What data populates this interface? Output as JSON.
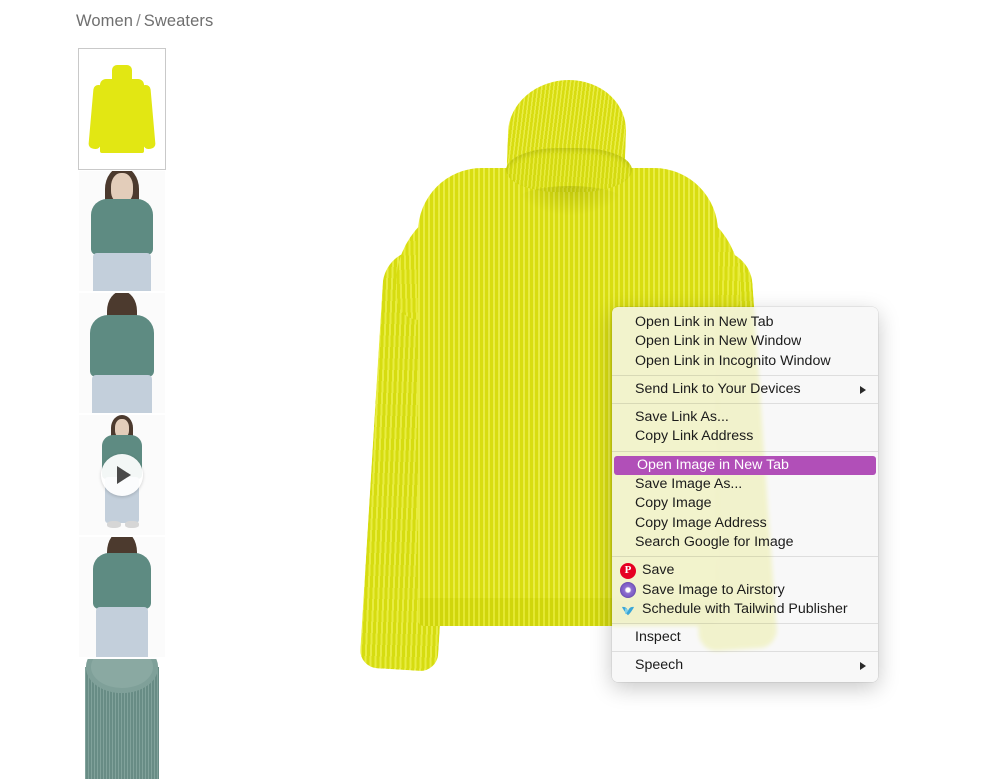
{
  "breadcrumb": {
    "items": [
      "Women",
      "Sweaters"
    ],
    "separator": "/"
  },
  "gallery": {
    "thumbnails": [
      {
        "name": "yellow-turtleneck-flat",
        "selected": true,
        "has_video": false,
        "kind": "product-flat",
        "color": "#e2e713"
      },
      {
        "name": "teal-turtleneck-front",
        "selected": false,
        "has_video": false,
        "kind": "model-front",
        "color": "#5e8b82"
      },
      {
        "name": "teal-turtleneck-back",
        "selected": false,
        "has_video": false,
        "kind": "model-back",
        "color": "#5e8b82"
      },
      {
        "name": "teal-turtleneck-video",
        "selected": false,
        "has_video": true,
        "kind": "model-full",
        "color": "#5e8b82"
      },
      {
        "name": "teal-turtleneck-side",
        "selected": false,
        "has_video": false,
        "kind": "model-side",
        "color": "#5e8b82"
      },
      {
        "name": "teal-knit-detail",
        "selected": false,
        "has_video": false,
        "kind": "fabric-detail",
        "color": "#6e948c"
      }
    ],
    "play_icon": "play-icon"
  },
  "hero": {
    "name": "yellow-ribbed-turtleneck-sweater",
    "color": "#e4e814"
  },
  "context_menu": {
    "highlight_color": "#b14fb8",
    "groups": [
      {
        "items": [
          {
            "label": "Open Link in New Tab",
            "submenu": false,
            "highlighted": false,
            "icon": null
          },
          {
            "label": "Open Link in New Window",
            "submenu": false,
            "highlighted": false,
            "icon": null
          },
          {
            "label": "Open Link in Incognito Window",
            "submenu": false,
            "highlighted": false,
            "icon": null
          }
        ]
      },
      {
        "items": [
          {
            "label": "Send Link to Your Devices",
            "submenu": true,
            "highlighted": false,
            "icon": null
          }
        ]
      },
      {
        "items": [
          {
            "label": "Save Link As...",
            "submenu": false,
            "highlighted": false,
            "icon": null
          },
          {
            "label": "Copy Link Address",
            "submenu": false,
            "highlighted": false,
            "icon": null
          }
        ]
      },
      {
        "items": [
          {
            "label": "Open Image in New Tab",
            "submenu": false,
            "highlighted": true,
            "icon": null
          },
          {
            "label": "Save Image As...",
            "submenu": false,
            "highlighted": false,
            "icon": null
          },
          {
            "label": "Copy Image",
            "submenu": false,
            "highlighted": false,
            "icon": null
          },
          {
            "label": "Copy Image Address",
            "submenu": false,
            "highlighted": false,
            "icon": null
          },
          {
            "label": "Search Google for Image",
            "submenu": false,
            "highlighted": false,
            "icon": null
          }
        ]
      },
      {
        "items": [
          {
            "label": "Save",
            "submenu": false,
            "highlighted": false,
            "icon": "pinterest-icon"
          },
          {
            "label": "Save Image to Airstory",
            "submenu": false,
            "highlighted": false,
            "icon": "airstory-icon"
          },
          {
            "label": "Schedule with Tailwind Publisher",
            "submenu": false,
            "highlighted": false,
            "icon": "tailwind-icon"
          }
        ]
      },
      {
        "items": [
          {
            "label": "Inspect",
            "submenu": false,
            "highlighted": false,
            "icon": null
          }
        ]
      },
      {
        "items": [
          {
            "label": "Speech",
            "submenu": true,
            "highlighted": false,
            "icon": null
          }
        ]
      }
    ]
  }
}
